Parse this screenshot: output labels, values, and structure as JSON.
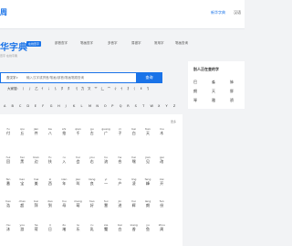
{
  "header": {
    "logo_fragment": "周",
    "link1": "新华字典",
    "link2": "汉语"
  },
  "brand": {
    "title": "华字典",
    "badge": "在线查字",
    "subtitle": "查字 在线字典"
  },
  "nav": {
    "items": [
      "部首查字",
      "笔画查字",
      "多音字",
      "易错字",
      "常用字",
      "笔画查询"
    ]
  },
  "search": {
    "type_label": "查汉字",
    "placeholder": "输入汉字或拼音/笔画/部首/笔画笔顺查询",
    "button": "查询"
  },
  "radicals": {
    "label": "大家搜:",
    "items": [
      "丨",
      "丿",
      "乙",
      "亻",
      "冫",
      "讠",
      "阝",
      "阝",
      "刂",
      "力",
      "又",
      "艹",
      "辶",
      "宀",
      "彳",
      "忄",
      "扌",
      "氵",
      "纟",
      "饣"
    ]
  },
  "letters": [
    "A",
    "B",
    "C",
    "D",
    "E",
    "F",
    "G",
    "H",
    "J",
    "K",
    "L",
    "M",
    "N",
    "O",
    "P",
    "Q",
    "R",
    "S",
    "T",
    "W",
    "X",
    "Y",
    "Z"
  ],
  "panel": {
    "more": "更多",
    "rows": [
      [
        [
          "fu",
          "付"
        ],
        [
          "qiu",
          "丘"
        ],
        [
          "jian",
          "件"
        ],
        [
          "ba",
          "八"
        ],
        [
          "shi",
          "拾"
        ],
        [
          "qian",
          "千"
        ],
        [
          "gu",
          "古"
        ],
        [
          "guang",
          "广"
        ],
        [
          "zi",
          "子"
        ],
        [
          "bai",
          "白"
        ],
        [
          "tian",
          "天"
        ],
        [
          "mu",
          "木"
        ]
      ],
      [
        [
          "hui",
          "回"
        ],
        [
          "hei",
          "黑"
        ],
        [
          "bian",
          "边"
        ],
        [
          "fu",
          "扶"
        ],
        [
          "ru",
          "入"
        ],
        [
          "hui",
          "会"
        ],
        [
          "you",
          "右"
        ],
        [
          "liu",
          "流"
        ],
        [
          "he",
          "合"
        ],
        [
          "hei",
          "嘿"
        ],
        [
          "jian",
          "见"
        ],
        [
          "gai",
          "改"
        ]
      ],
      [
        [
          "fan",
          "番"
        ],
        [
          "bao",
          "宝"
        ],
        [
          "mei",
          "美"
        ],
        [
          "xi",
          "西"
        ],
        [
          "nian",
          "年"
        ],
        [
          "jiao",
          "叫"
        ],
        [
          "liang",
          "良"
        ],
        [
          "yi",
          "一"
        ],
        [
          "hu",
          "户"
        ],
        [
          "ling",
          "凌"
        ],
        [
          "feng",
          "峰"
        ],
        [
          "kai",
          "开"
        ]
      ],
      [
        [
          "hao",
          "浩"
        ],
        [
          "chao",
          "超"
        ],
        [
          "bai",
          "拜"
        ],
        [
          "dao",
          "到"
        ],
        [
          "mu",
          "母"
        ],
        [
          "meng",
          "萌"
        ],
        [
          "hao",
          "好"
        ],
        [
          "hui",
          "慧"
        ],
        [
          "jin",
          "进"
        ],
        [
          "hui",
          "辉"
        ],
        [
          "lang",
          "朗"
        ],
        [
          "fen",
          "份"
        ]
      ],
      [
        [
          "mu",
          "沐"
        ],
        [
          "you",
          "游"
        ],
        [
          "he",
          "荷"
        ],
        [
          "ri",
          "日"
        ],
        [
          "du",
          "堵"
        ],
        [
          "le",
          "乐"
        ],
        [
          "ru",
          "乳"
        ],
        [
          "xie",
          "蟹"
        ],
        [
          "bai",
          "白"
        ],
        [
          "xiang",
          "香"
        ],
        [
          "yu",
          "鱼"
        ],
        [
          "zhou",
          "周"
        ]
      ]
    ]
  },
  "sidebar": {
    "title": "别人正在查的字",
    "chars": [
      "巴",
      "淼",
      "姊",
      "朗",
      "天",
      "胖",
      "琴",
      "雅",
      "骄"
    ]
  }
}
